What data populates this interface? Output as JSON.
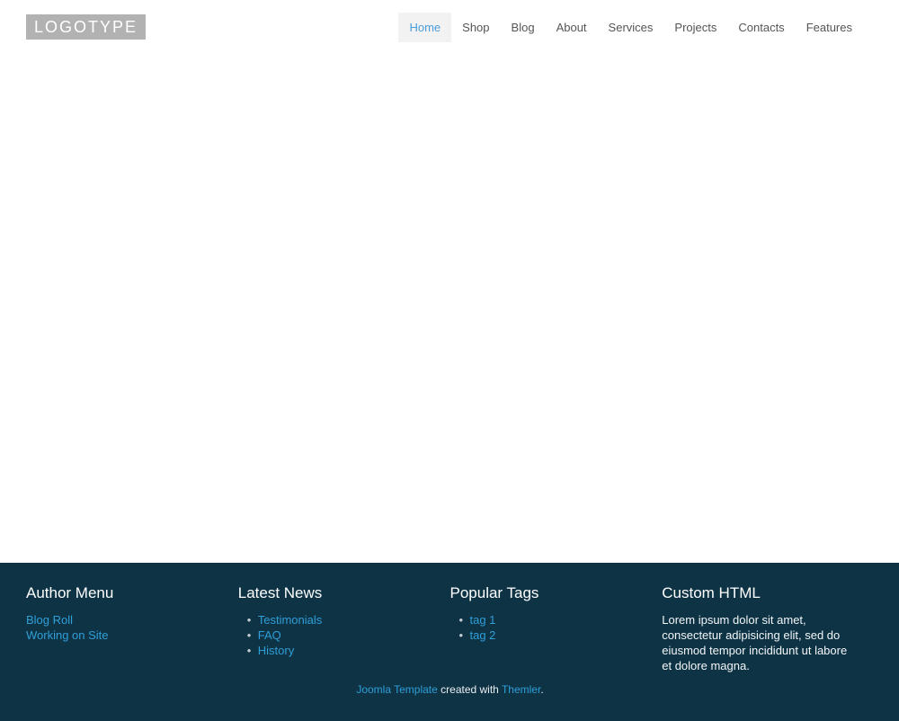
{
  "theme": {
    "footer_bg": "#0e3345",
    "link_blue": "#2f9fd8",
    "nav_active_blue": "#4a9dd9",
    "nav_text": "#555555",
    "logo_bg": "#b2b2b2",
    "active_item_bg": "#f2f2f2",
    "bullet_color": "#c2ccd1"
  },
  "header": {
    "logo": "LOGOTYPE",
    "nav": [
      {
        "label": "Home",
        "active": true
      },
      {
        "label": "Shop",
        "active": false
      },
      {
        "label": "Blog",
        "active": false
      },
      {
        "label": "About",
        "active": false
      },
      {
        "label": "Services",
        "active": false
      },
      {
        "label": "Projects",
        "active": false
      },
      {
        "label": "Contacts",
        "active": false
      },
      {
        "label": "Features",
        "active": false
      }
    ]
  },
  "footer": {
    "columns": [
      {
        "title": "Author Menu",
        "links": [
          "Blog Roll",
          "Working on Site"
        ]
      },
      {
        "title": "Latest News",
        "links": [
          "Testimonials",
          "FAQ",
          "History"
        ]
      },
      {
        "title": "Popular Tags",
        "links": [
          "tag 1",
          "tag 2"
        ]
      },
      {
        "title": "Custom HTML",
        "text": "Lorem ipsum dolor sit amet, consectetur adipisicing elit, sed do eiusmod tempor incididunt ut labore et dolore magna."
      }
    ],
    "credit": {
      "link1": "Joomla Template",
      "middle": " created with ",
      "link2": "Themler",
      "end": "."
    }
  }
}
